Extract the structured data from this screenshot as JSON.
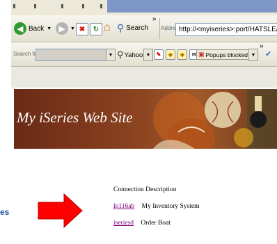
{
  "toolbar": {
    "back_label": "Back",
    "search_label": "Search",
    "chevron": "»",
    "address_label": "Address",
    "address_value": "http://<myiseries>:port/HATSLE/"
  },
  "searchbar": {
    "search_for_label": "Search for",
    "provider": "Yahoo!",
    "popups_label": "Popups blocked",
    "chevron": "»"
  },
  "page": {
    "banner_title": "My iSeries Web Site",
    "table": {
      "header": "Connection Description",
      "rows": [
        {
          "link": "lp116ab",
          "description": "My Inventory System"
        },
        {
          "link": "iseriesd",
          "description": "Order Boat"
        }
      ]
    }
  },
  "slide_fragment": "es",
  "colors": {
    "arrow_fill": "#ff0000",
    "link_visited": "#800080",
    "banner_brown": "#8a4220"
  }
}
